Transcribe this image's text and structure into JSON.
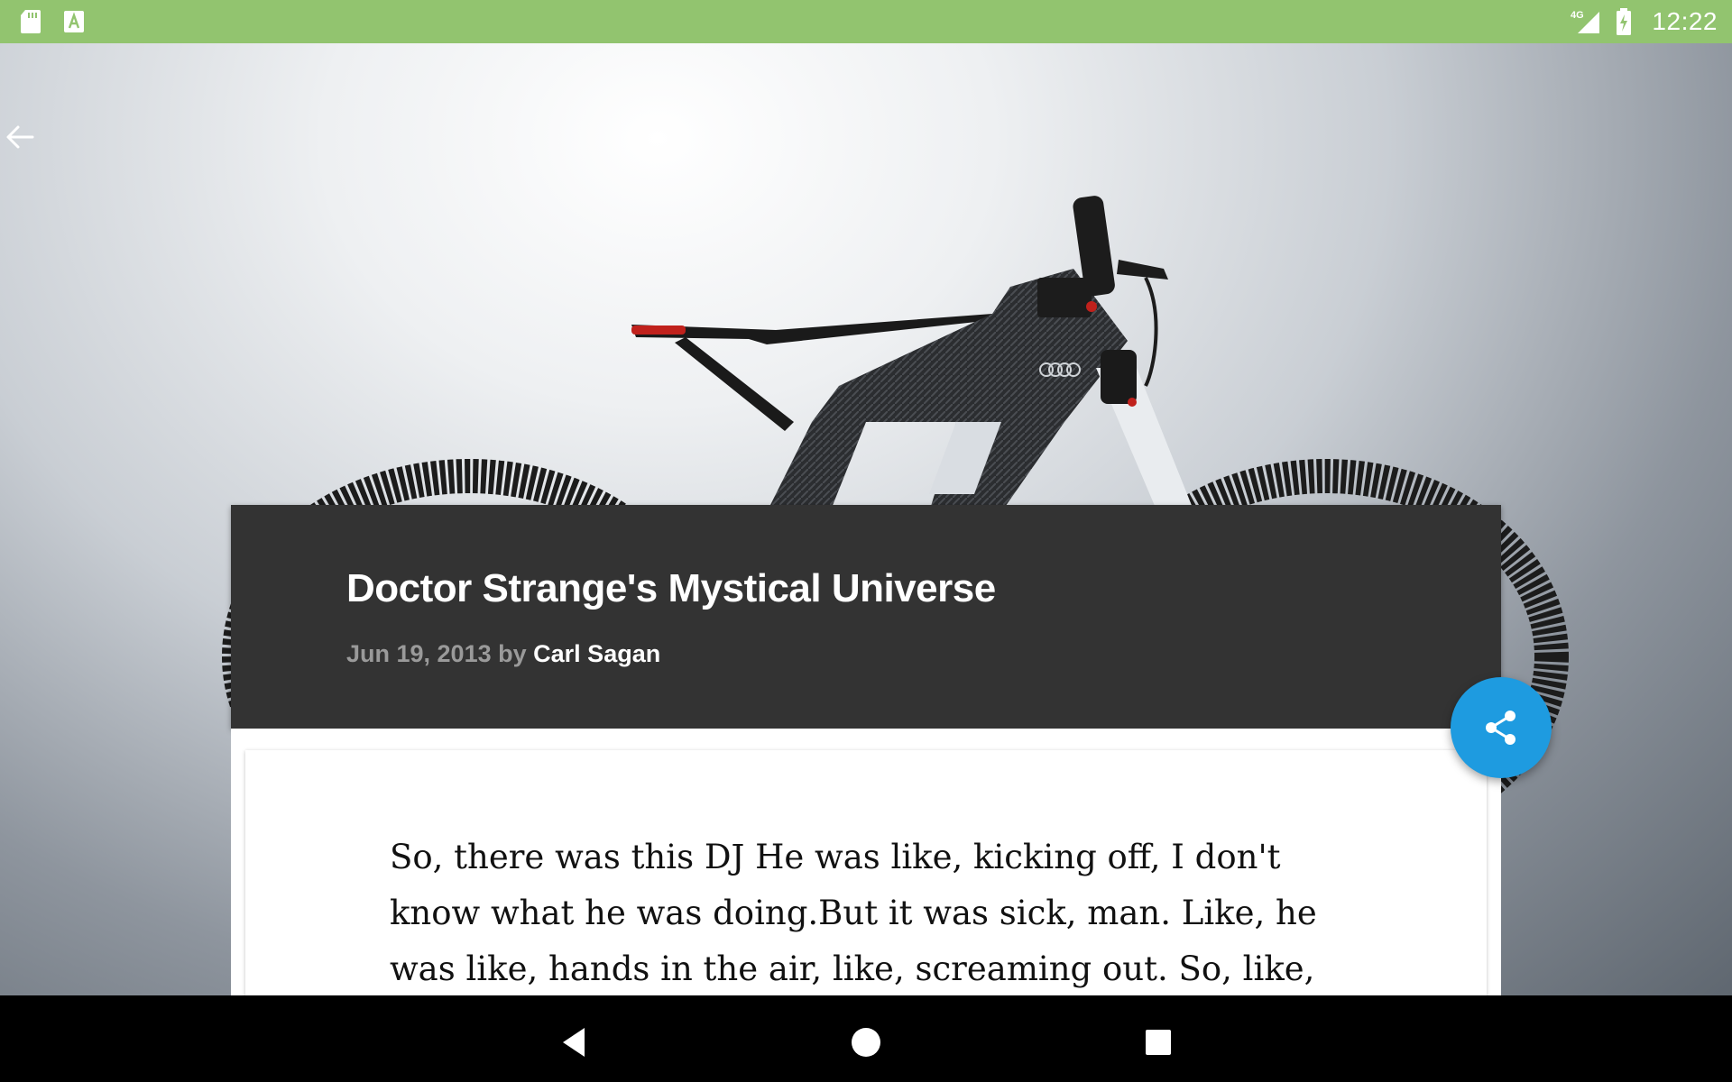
{
  "status_bar": {
    "time": "12:22",
    "network": "4G",
    "icons": [
      "sd-card-icon",
      "text-a-icon",
      "signal-4g-icon",
      "battery-charging-icon"
    ]
  },
  "toolbar": {
    "back_icon": "arrow-left-icon"
  },
  "post": {
    "title": "Doctor Strange's Mystical Universe",
    "date": "Jun 19, 2013",
    "by": "by",
    "author": "Carl Sagan",
    "body": "So, there was this DJ He was like, kicking off, I don't know what he was doing.But it was sick, man. Like, he was like, hands in the air, like, screaming out. So, like, this clown started covering"
  },
  "fab": {
    "icon": "share-icon",
    "color": "#1e9be0"
  },
  "nav_bar": {
    "icons": [
      "back-triangle-icon",
      "home-circle-icon",
      "recents-square-icon"
    ]
  },
  "colors": {
    "status_bar": "#92c46f",
    "header_card": "#333333",
    "accent": "#1e9be0"
  }
}
